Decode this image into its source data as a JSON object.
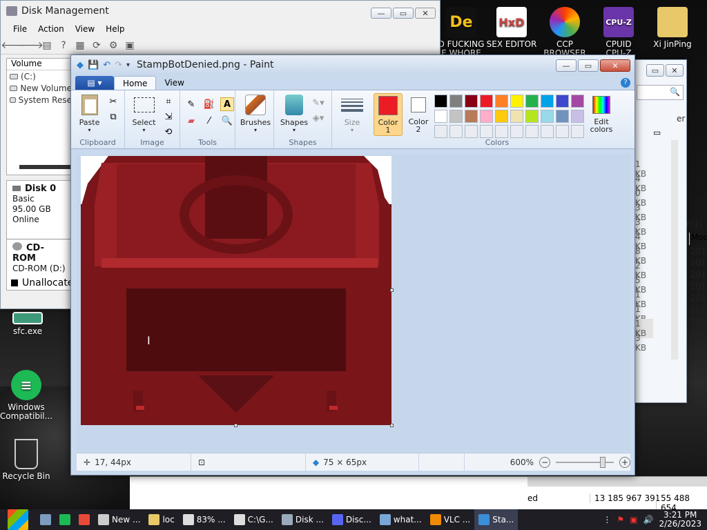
{
  "desktop": {
    "icons": [
      {
        "label": "D FUCKING\nE WHORE",
        "name": "decompiler-icon",
        "color": "#f2c01d",
        "glyph": "De"
      },
      {
        "label": "SEX EDITOR",
        "name": "hxd-icon",
        "color": "#fdfdfd",
        "glyph": "HxD"
      },
      {
        "label": "CCP\nBROWSER",
        "name": "ccp-browser-icon",
        "color": "#ff5a20",
        "glyph": ""
      },
      {
        "label": "CPUID\nCPU-Z",
        "name": "cpuz-icon",
        "color": "#7b3fb5",
        "glyph": "CPU-Z"
      },
      {
        "label": "Xi JinPing",
        "name": "user-folder-icon",
        "color": "#e8c96a",
        "glyph": ""
      }
    ],
    "left_icons": [
      {
        "label": "sfc.exe",
        "name": "sfc-exe-icon"
      },
      {
        "label": "Windows\nCompatibil...",
        "name": "windows-compat-icon"
      },
      {
        "label": "Recycle Bin",
        "name": "recycle-bin-icon"
      }
    ]
  },
  "disk_management": {
    "title": "Disk Management",
    "menu": [
      "File",
      "Action",
      "View",
      "Help"
    ],
    "volume_header": "Volume",
    "volumes": [
      "(C:)",
      "New Volume",
      "System Rese"
    ],
    "disk0": {
      "name": "Disk 0",
      "type": "Basic",
      "size": "95.00 GB",
      "status": "Online"
    },
    "cdrom": {
      "name": "CD-ROM",
      "drive": "CD-ROM (D:)"
    },
    "legend": "Unallocate"
  },
  "explorer": {
    "sizes": [
      "1 KB",
      "4 KB",
      "0 KB",
      "3 KB",
      "3 KB",
      "4 KB",
      "8 KB",
      "2 KB",
      "5 KB",
      "1 KB",
      "1 KB",
      "1 KB",
      "3 KB"
    ],
    "dates": [
      "2014",
      "2013",
      "2013",
      "2014",
      "2013",
      "2014",
      "2013",
      "2014",
      "2014",
      "2013"
    ],
    "path_fragment": "n\\1\\",
    "date_header": "Mod",
    "er_label": "er",
    "bottom_left": "ed",
    "bottom_mid": "13 185 967 391",
    "bottom_right": "55 488 654"
  },
  "paint": {
    "title": "StampBotDenied.png - Paint",
    "tabs": {
      "home": "Home",
      "view": "View"
    },
    "groups": {
      "clipboard": "Clipboard",
      "image": "Image",
      "tools": "Tools",
      "shapes": "Shapes",
      "colors": "Colors"
    },
    "buttons": {
      "paste": "Paste",
      "select": "Select",
      "brushes": "Brushes",
      "shapes": "Shapes",
      "size": "Size",
      "color1": "Color\n1",
      "color2": "Color\n2",
      "edit_colors": "Edit\ncolors"
    },
    "color1": "#ec1c24",
    "color2": "#ffffff",
    "palette": [
      "#000000",
      "#7f7f7f",
      "#880015",
      "#ed1c24",
      "#ff7f27",
      "#fff200",
      "#22b14c",
      "#00a2e8",
      "#3f48cc",
      "#a349a4",
      "#ffffff",
      "#c3c3c3",
      "#b97a57",
      "#ffaec9",
      "#ffc90e",
      "#efe4b0",
      "#b5e61d",
      "#99d9ea",
      "#7092be",
      "#c8bfe7"
    ],
    "status": {
      "cursor_pos": "17, 44px",
      "image_size": "75 × 65px",
      "zoom": "600%"
    }
  },
  "taskbar": {
    "items": [
      {
        "label": "",
        "name": "start-button",
        "color": "#1e90ff"
      },
      {
        "label": "",
        "name": "taskbar-app-1",
        "color": "#7c9cc0"
      },
      {
        "label": "",
        "name": "taskbar-spotify",
        "color": "#1db954"
      },
      {
        "label": "",
        "name": "taskbar-chrome",
        "color": "#e84a3a"
      },
      {
        "label": "New ...",
        "name": "taskbar-new",
        "color": "#ccc"
      },
      {
        "label": "loc",
        "name": "taskbar-loc-folder",
        "color": "#e8c96a"
      },
      {
        "label": "83% ...",
        "name": "taskbar-7zip",
        "color": "#ddd"
      },
      {
        "label": "C:\\G...",
        "name": "taskbar-7zip-2",
        "color": "#ddd"
      },
      {
        "label": "Disk ...",
        "name": "taskbar-disk-management",
        "color": "#9ab"
      },
      {
        "label": "Disc...",
        "name": "taskbar-discord",
        "color": "#5865f2"
      },
      {
        "label": "what...",
        "name": "taskbar-what",
        "color": "#7aa7d8"
      },
      {
        "label": "VLC ...",
        "name": "taskbar-vlc",
        "color": "#f08a00"
      },
      {
        "label": "Sta...",
        "name": "taskbar-stampbot-paint",
        "color": "#3b8ed8"
      }
    ],
    "time": "3:21 PM",
    "date": "2/26/2023"
  }
}
